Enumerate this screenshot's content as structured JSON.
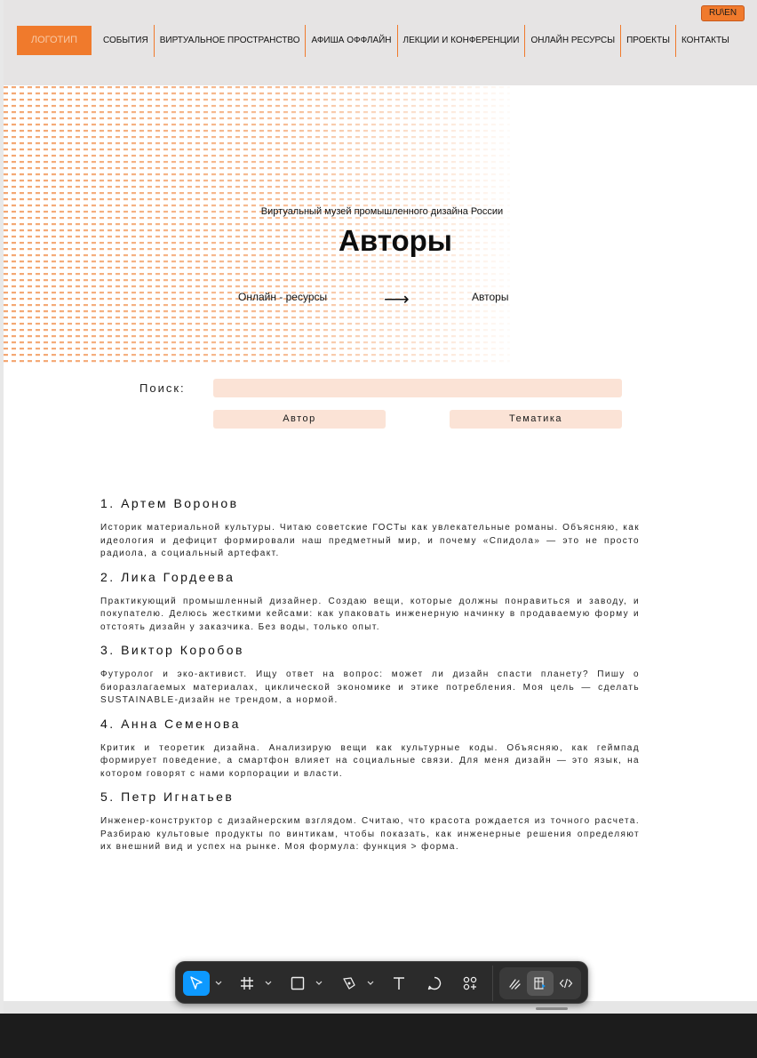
{
  "header": {
    "lang": "RU\\EN",
    "logo": "ЛОГОТИП",
    "nav": [
      "СОБЫТИЯ",
      "ВИРТУАЛЬНОЕ ПРОСТРАНСТВО",
      "АФИША ОФФЛАЙН",
      "ЛЕКЦИИ И КОНФЕРЕНЦИИ",
      "ОНЛАЙН РЕСУРСЫ",
      "ПРОЕКТЫ",
      "КОНТАКТЫ"
    ]
  },
  "hero": {
    "subtitle": "Виртуальный музей промышленного дизайна России",
    "title": "Авторы",
    "breadcrumb": {
      "parent": "Онлайн - ресурсы",
      "arrow": "⟶",
      "current": "Авторы"
    }
  },
  "search": {
    "label": "Поиск:",
    "value": "",
    "placeholder": "",
    "filters": [
      "Автор",
      "Тематика"
    ]
  },
  "authors": [
    {
      "name": "1. Артем Воронов",
      "desc": "Историк материальной культуры. Читаю советские ГОСТы как увлекательные романы. Объясняю, как идеология и дефицит формировали наш предметный мир, и почему «Спидола» — это не просто радиола, а социальный артефакт."
    },
    {
      "name": "2. Лика Гордеева",
      "desc": "Практикующий промышленный дизайнер. Создаю вещи, которые должны понравиться и заводу, и покупателю. Делюсь жесткими кейсами: как упаковать инженерную начинку в продаваемую форму и отстоять дизайн у заказчика. Без воды, только опыт."
    },
    {
      "name": "3. Виктор Коробов",
      "desc": "Футуролог и эко-активист. Ищу ответ на вопрос: может ли дизайн спасти планету? Пишу о биоразлагаемых материалах, циклической экономике и этике потребления. Моя цель — сделать SUSTAINABLE-дизайн не трендом, а нормой."
    },
    {
      "name": "4. Анна Семенова",
      "desc": "Критик и теоретик дизайна. Анализирую вещи как культурные коды. Объясняю, как геймпад формирует поведение, а смартфон влияет на социальные связи. Для меня дизайн — это язык, на котором говорят с нами корпорации и власти."
    },
    {
      "name": "5. Петр Игнатьев",
      "desc": "Инженер-конструктор с дизайнерским взглядом. Считаю, что красота рождается из точного расчета. Разбираю культовые продукты по винтикам, чтобы показать, как инженерные решения определяют их внешний вид и успех на рынке. Моя формула: функция > форма."
    }
  ],
  "colors": {
    "accent": "#f07a2c",
    "field_bg": "#fbe3d6",
    "header_bg": "#e6e4e4",
    "toolbar_bg": "#2b2b2b",
    "tool_active": "#0d99ff"
  },
  "toolbar": {
    "tools": [
      "move-icon",
      "frame-icon",
      "rectangle-icon",
      "pen-icon",
      "text-icon",
      "comment-icon",
      "actions-icon"
    ],
    "modes": [
      "draw-icon",
      "design-icon",
      "dev-mode-icon"
    ]
  }
}
